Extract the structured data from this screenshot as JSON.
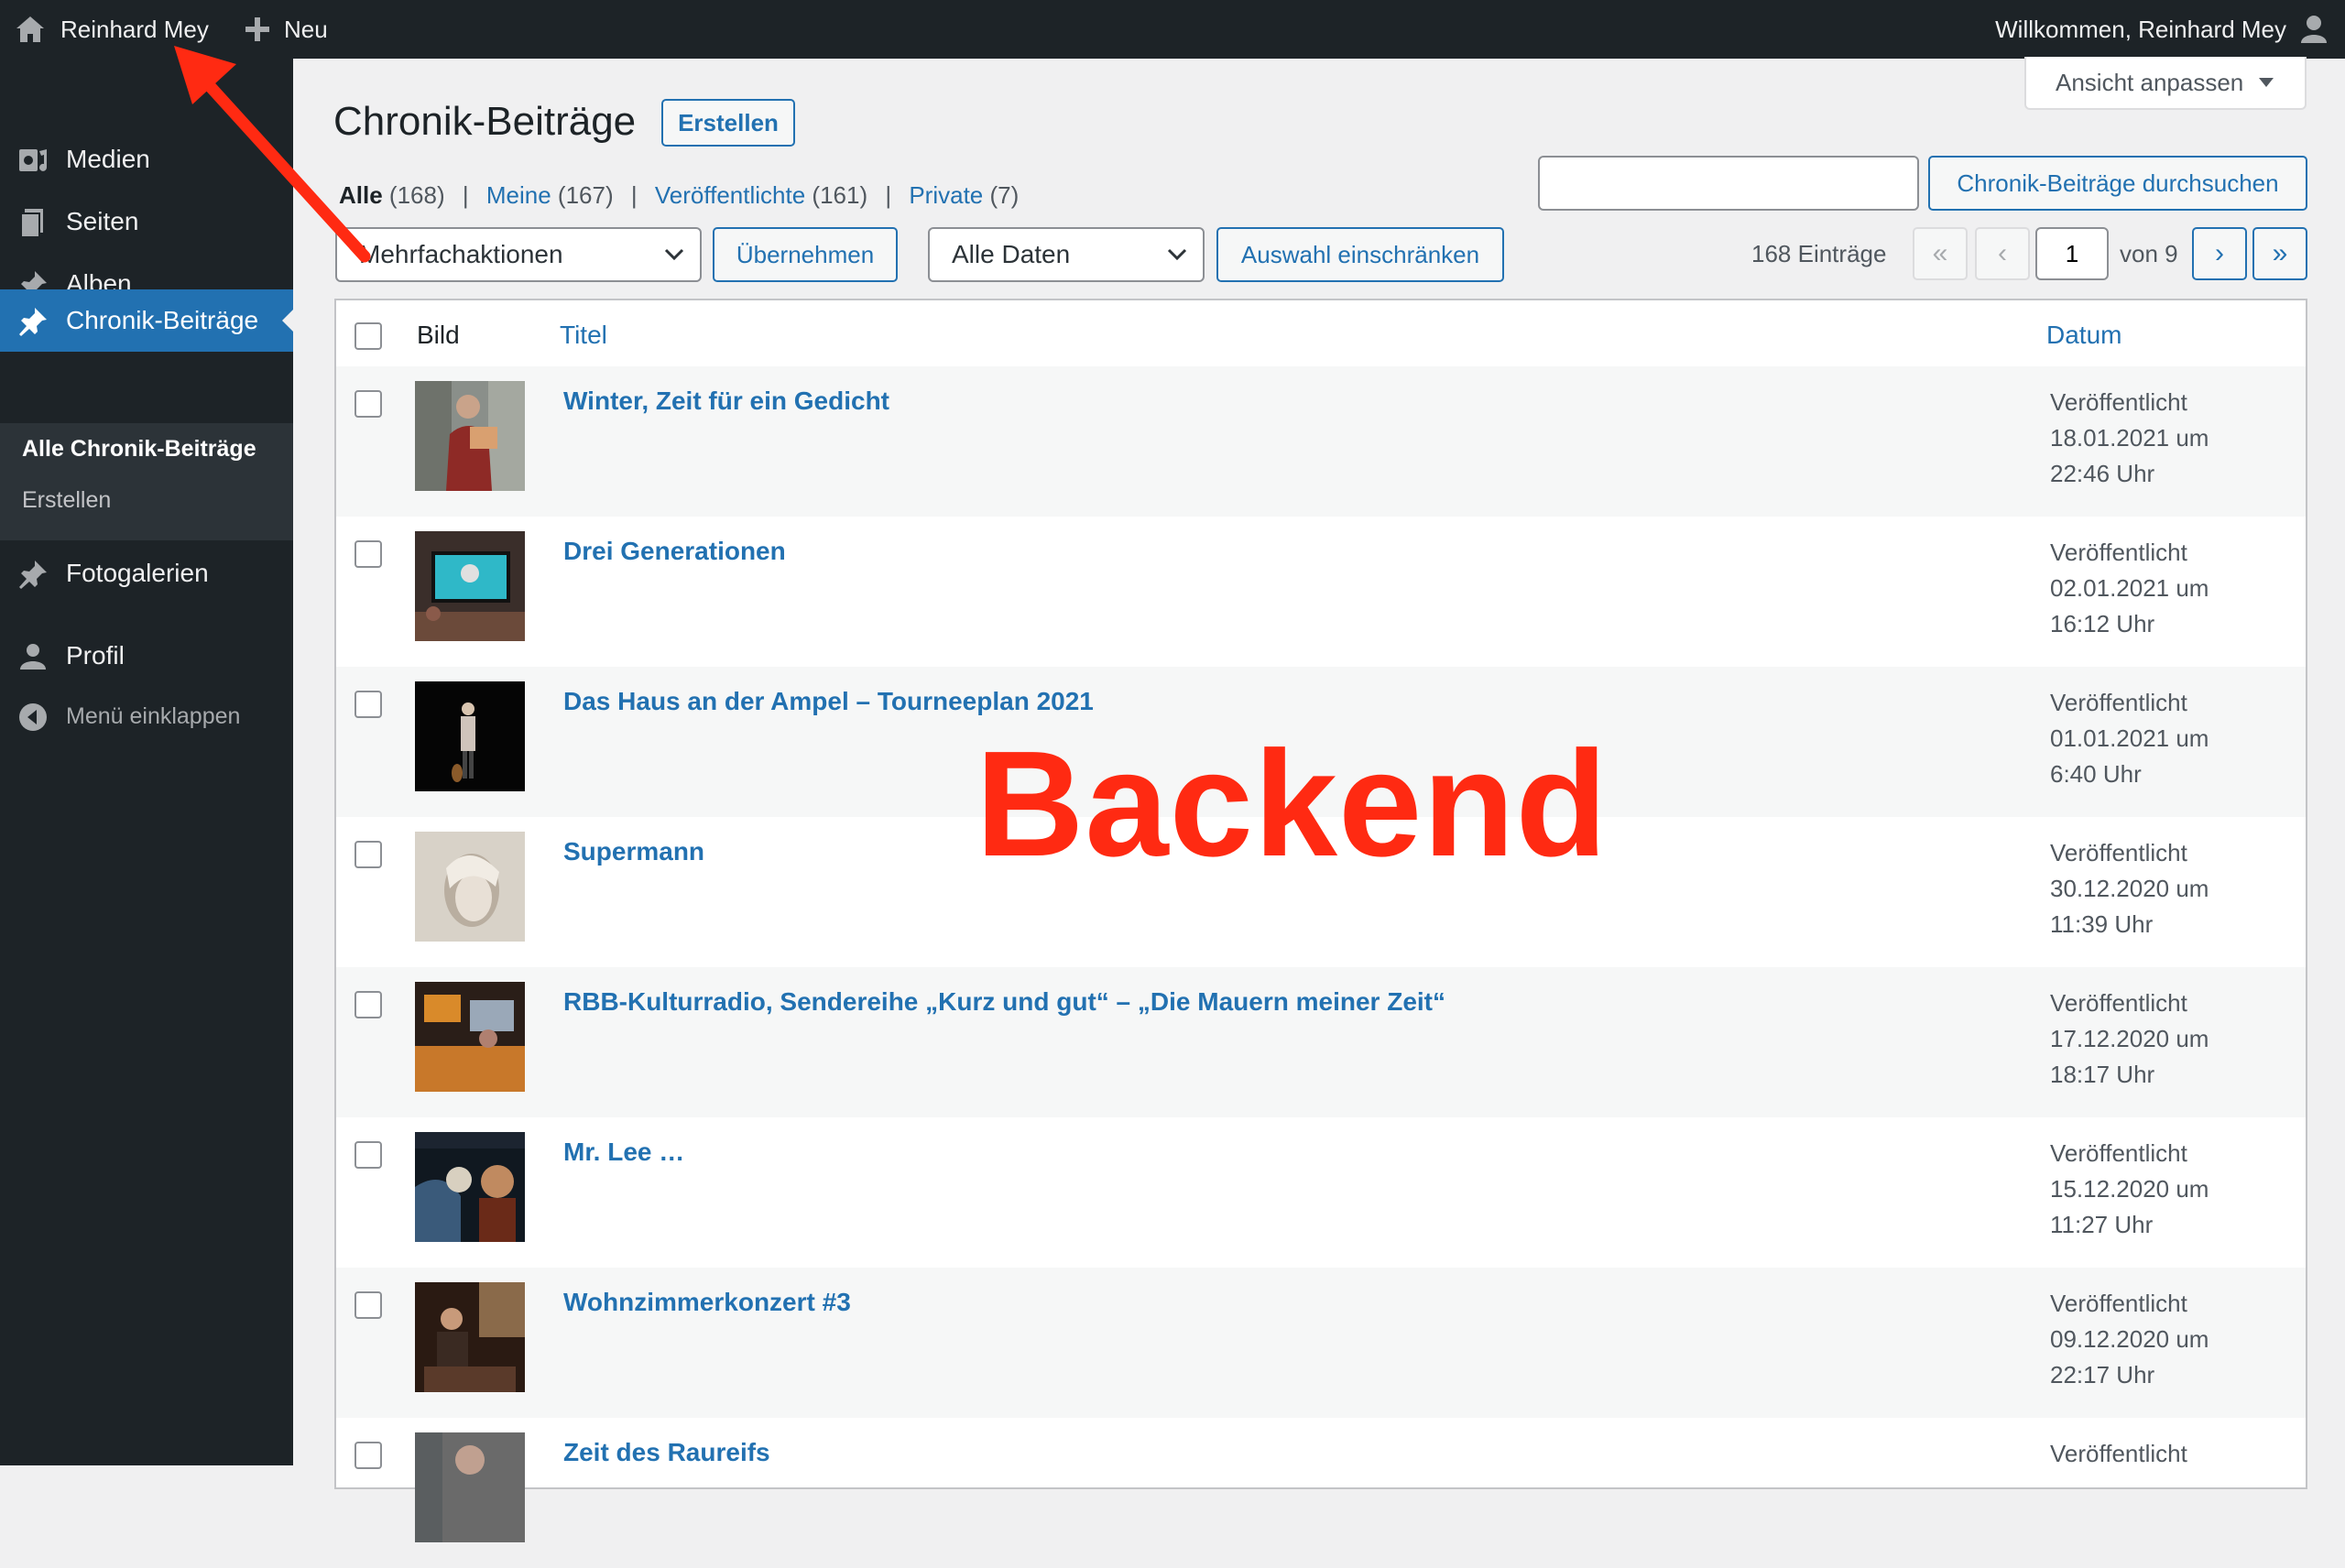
{
  "adminbar": {
    "site_name": "Reinhard Mey",
    "new_label": "Neu",
    "greeting": "Willkommen, Reinhard Mey"
  },
  "sidebar": {
    "items": [
      {
        "label": "Medien",
        "icon": "media-icon"
      },
      {
        "label": "Seiten",
        "icon": "pages-icon"
      },
      {
        "label": "Alben",
        "icon": "pin-icon"
      },
      {
        "label": "Chronik-Beiträge",
        "icon": "pin-icon",
        "current": true
      },
      {
        "label": "Fotogalerien",
        "icon": "pin-icon"
      },
      {
        "label": "Profil",
        "icon": "user-icon"
      }
    ],
    "submenu": [
      "Alle Chronik-Beiträge",
      "Erstellen"
    ],
    "collapse_label": "Menü einklappen"
  },
  "screen_options": "Ansicht anpassen",
  "page": {
    "title": "Chronik-Beiträge",
    "add_new": "Erstellen"
  },
  "views": {
    "all_label": "Alle",
    "all_count": "(168)",
    "mine_label": "Meine",
    "mine_count": "(167)",
    "published_label": "Veröffentlichte",
    "published_count": "(161)",
    "private_label": "Private",
    "private_count": "(7)",
    "separator": "|"
  },
  "search": {
    "value": "",
    "button": "Chronik-Beiträge durchsuchen"
  },
  "tablenav": {
    "bulk_select": "Mehrfachaktionen",
    "apply": "Übernehmen",
    "date_select": "Alle Daten",
    "filter": "Auswahl einschränken",
    "items_count": "168 Einträge",
    "first": "«",
    "prev": "‹",
    "current_page": "1",
    "of_label": "von 9",
    "next": "›",
    "last": "»"
  },
  "table": {
    "columns": {
      "image": "Bild",
      "title": "Titel",
      "date": "Datum"
    },
    "rows": [
      {
        "title": "Winter, Zeit für ein Gedicht",
        "status": "Veröffentlicht",
        "date": "18.01.2021 um",
        "time": "22:46 Uhr"
      },
      {
        "title": "Drei Generationen",
        "status": "Veröffentlicht",
        "date": "02.01.2021 um",
        "time": "16:12 Uhr"
      },
      {
        "title": "Das Haus an der Ampel – Tourneeplan 2021",
        "status": "Veröffentlicht",
        "date": "01.01.2021 um",
        "time": "6:40 Uhr"
      },
      {
        "title": "Supermann",
        "status": "Veröffentlicht",
        "date": "30.12.2020 um",
        "time": "11:39 Uhr"
      },
      {
        "title": "RBB-Kulturradio, Sendereihe „Kurz und gut“ – „Die Mauern meiner Zeit“",
        "status": "Veröffentlicht",
        "date": "17.12.2020 um",
        "time": "18:17 Uhr"
      },
      {
        "title": "Mr. Lee …",
        "status": "Veröffentlicht",
        "date": "15.12.2020 um",
        "time": "11:27 Uhr"
      },
      {
        "title": "Wohnzimmerkonzert #3",
        "status": "Veröffentlicht",
        "date": "09.12.2020 um",
        "time": "22:17 Uhr"
      },
      {
        "title": "Zeit des Raureifs",
        "status": "Veröffentlicht",
        "date": "",
        "time": ""
      }
    ]
  },
  "overlay": {
    "label": "Backend",
    "color": "#ff2a12"
  },
  "colors": {
    "accent": "#2271b1",
    "menu_bg": "#1d2327"
  }
}
